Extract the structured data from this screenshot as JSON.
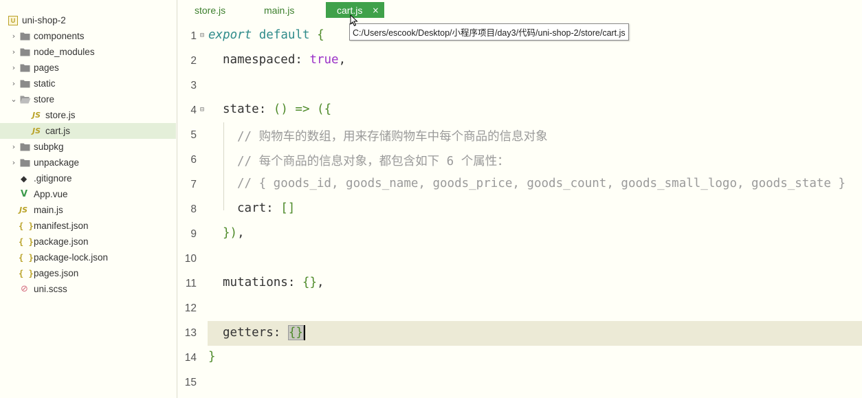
{
  "sidebar": {
    "project": "uni-shop-2",
    "items": [
      {
        "label": "components",
        "type": "folder"
      },
      {
        "label": "node_modules",
        "type": "folder"
      },
      {
        "label": "pages",
        "type": "folder"
      },
      {
        "label": "static",
        "type": "folder"
      },
      {
        "label": "store",
        "type": "folder-open"
      },
      {
        "label": "store.js",
        "type": "js"
      },
      {
        "label": "cart.js",
        "type": "js"
      },
      {
        "label": "subpkg",
        "type": "folder"
      },
      {
        "label": "unpackage",
        "type": "folder"
      },
      {
        "label": ".gitignore",
        "type": "git"
      },
      {
        "label": "App.vue",
        "type": "vue"
      },
      {
        "label": "main.js",
        "type": "js"
      },
      {
        "label": "manifest.json",
        "type": "json"
      },
      {
        "label": "package.json",
        "type": "json"
      },
      {
        "label": "package-lock.json",
        "type": "json"
      },
      {
        "label": "pages.json",
        "type": "json"
      },
      {
        "label": "uni.scss",
        "type": "scss"
      }
    ],
    "icons": {
      "js": "JS",
      "json": "{ }",
      "vue": "V",
      "git": "◆",
      "scss": "⊘",
      "project": "U"
    }
  },
  "tabs": [
    {
      "label": "store.js"
    },
    {
      "label": "main.js"
    },
    {
      "label": "cart.js",
      "close": "×"
    }
  ],
  "tooltip": "C:/Users/escook/Desktop/小程序项目/day3/代码/uni-shop-2/store/cart.js",
  "editor": {
    "line_numbers": [
      "1",
      "2",
      "3",
      "4",
      "5",
      "6",
      "7",
      "8",
      "9",
      "10",
      "11",
      "12",
      "13",
      "14",
      "15"
    ],
    "fold_marker": "⊟",
    "l1": {
      "kw": "export",
      "kw2": "default",
      "brace": "{"
    },
    "l2": {
      "prop": "namespaced",
      "colon": ":",
      "value": "true",
      "comma": ","
    },
    "l4": {
      "prop": "state",
      "colon": ":",
      "parens": "()",
      "arrow": "=>",
      "open": "({"
    },
    "l5": "// 购物车的数组，用来存储购物车中每个商品的信息对象",
    "l6": "// 每个商品的信息对象，都包含如下 6 个属性：",
    "l7": "// { goods_id, goods_name, goods_price, goods_count, goods_small_logo, goods_state }",
    "l8": {
      "prop": "cart",
      "colon": ":",
      "value": "[]"
    },
    "l9": {
      "close": "})",
      "comma": ","
    },
    "l11": {
      "prop": "mutations",
      "colon": ":",
      "value": "{}",
      "comma": ","
    },
    "l13": {
      "prop": "getters",
      "colon": ":",
      "value": "{}"
    },
    "l14": {
      "close": "}"
    }
  },
  "colors": {
    "accent": "#3fa14a",
    "background": "#fffff7",
    "selected_row": "#e4efd9",
    "current_line": "#ecead6"
  }
}
